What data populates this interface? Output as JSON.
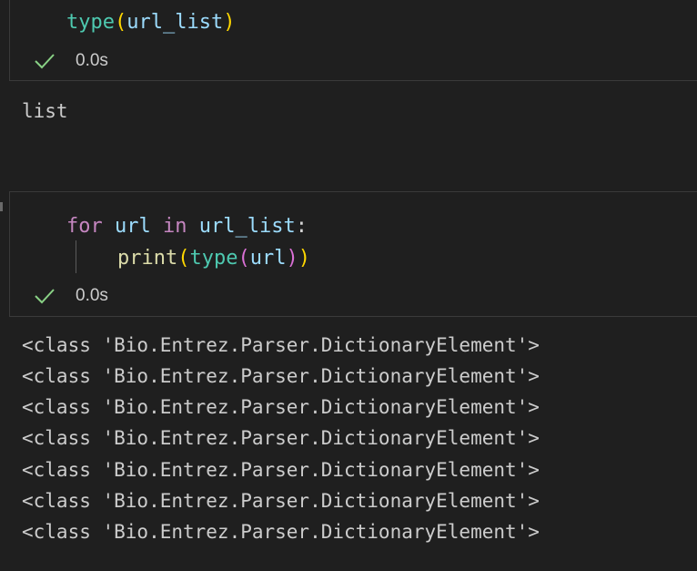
{
  "cell1": {
    "code": {
      "func": "type",
      "paren_open": "(",
      "arg": "url_list",
      "paren_close": ")"
    },
    "status": {
      "icon": "check-icon",
      "time": "0.0s"
    },
    "output": "list"
  },
  "cell2": {
    "line1": {
      "kw_for": "for",
      "var": "url",
      "kw_in": "in",
      "iter": "url_list",
      "colon": ":"
    },
    "line2": {
      "print": "print",
      "p1_open": "(",
      "type": "type",
      "p2_open": "(",
      "arg": "url",
      "p2_close": ")",
      "p1_close": ")"
    },
    "status": {
      "icon": "check-icon",
      "time": "0.0s"
    },
    "outputs": [
      "<class 'Bio.Entrez.Parser.DictionaryElement'>",
      "<class 'Bio.Entrez.Parser.DictionaryElement'>",
      "<class 'Bio.Entrez.Parser.DictionaryElement'>",
      "<class 'Bio.Entrez.Parser.DictionaryElement'>",
      "<class 'Bio.Entrez.Parser.DictionaryElement'>",
      "<class 'Bio.Entrez.Parser.DictionaryElement'>",
      "<class 'Bio.Entrez.Parser.DictionaryElement'>"
    ]
  },
  "colors": {
    "check": "#89d185",
    "background": "#1f1f1f",
    "border": "#3a3a3a"
  }
}
